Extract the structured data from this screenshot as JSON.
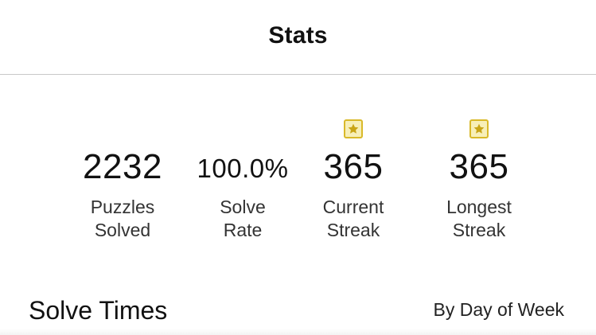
{
  "header": {
    "title": "Stats"
  },
  "stats": [
    {
      "value": "2232",
      "label_line1": "Puzzles",
      "label_line2": "Solved",
      "has_star": false
    },
    {
      "value": "100.0%",
      "label_line1": "Solve",
      "label_line2": "Rate",
      "has_star": false
    },
    {
      "value": "365",
      "label_line1": "Current",
      "label_line2": "Streak",
      "has_star": true,
      "icon": "star-badge-icon"
    },
    {
      "value": "365",
      "label_line1": "Longest",
      "label_line2": "Streak",
      "has_star": true,
      "icon": "star-badge-icon"
    }
  ],
  "solve_times": {
    "title": "Solve Times",
    "filter_label": "By Day of Week"
  },
  "colors": {
    "star_border": "#d9b92a",
    "star_fill": "#f7efb8",
    "star_glyph": "#c9a516",
    "divider": "#c8c8c8"
  }
}
